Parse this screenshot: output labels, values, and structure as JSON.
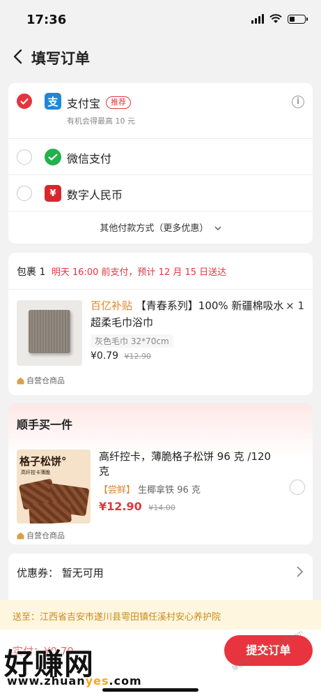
{
  "status_bar": {
    "time": "17:36",
    "battery_level": 0.35
  },
  "nav": {
    "title": "填写订单",
    "back_icon": "chevron-left-icon"
  },
  "payment": {
    "methods": [
      {
        "name": "支付宝",
        "badge": "推荐",
        "subtitle": "有机会得最高 10 元",
        "selected": true,
        "icon": "alipay-icon",
        "icon_color": "#1e88d6"
      },
      {
        "name": "微信支付",
        "selected": false,
        "icon": "wechat-pay-icon",
        "icon_color": "#22b14c"
      },
      {
        "name": "数字人民币",
        "selected": false,
        "icon": "digital-rmb-icon",
        "icon_color": "#d7272e"
      }
    ],
    "other": "其他付款方式（更多优惠）"
  },
  "package": {
    "label": "包裹 1",
    "delivery": "明天 16:00 前支付，预计 12 月 15 日送达",
    "item": {
      "subsidy_tag": "百亿补贴",
      "title": "【青春系列】100% 新疆棉吸水超柔毛巾浴巾",
      "quantity": "× 1",
      "spec": "灰色毛巾  32*70cm",
      "price": "¥0.79",
      "original_price": "¥12.90",
      "self_operated": "自营仓商品"
    }
  },
  "add_on": {
    "title": "顺手买一件",
    "item": {
      "image_title": "格子松饼°",
      "image_subtitle": "高纤控卡薄脆",
      "name": "高纤控卡，薄脆格子松饼 96 克 /120 克",
      "taste_tag": "【尝鲜】",
      "spec": "生椰拿铁 96 克",
      "price": "¥12.90",
      "original_price": "¥14.00",
      "self_operated": "自营仓商品"
    }
  },
  "coupon": {
    "label": "优惠券：  暂无可用"
  },
  "address": {
    "text": "送至：江西省吉安市遂川县雩田镇任溪村安心养护院"
  },
  "bottom": {
    "total_label": "实付：¥0.79",
    "submit": "提交订单"
  },
  "watermark": {
    "logo": "好赚网",
    "url_prefix": "www.zhuan",
    "url_highlight": "yes",
    "url_suffix": ".com",
    "faint": "赚客吧 www.zuanke8.com"
  },
  "colors": {
    "accent": "#e2363f",
    "orange": "#e0862a",
    "address_bg": "#fff6e0"
  }
}
